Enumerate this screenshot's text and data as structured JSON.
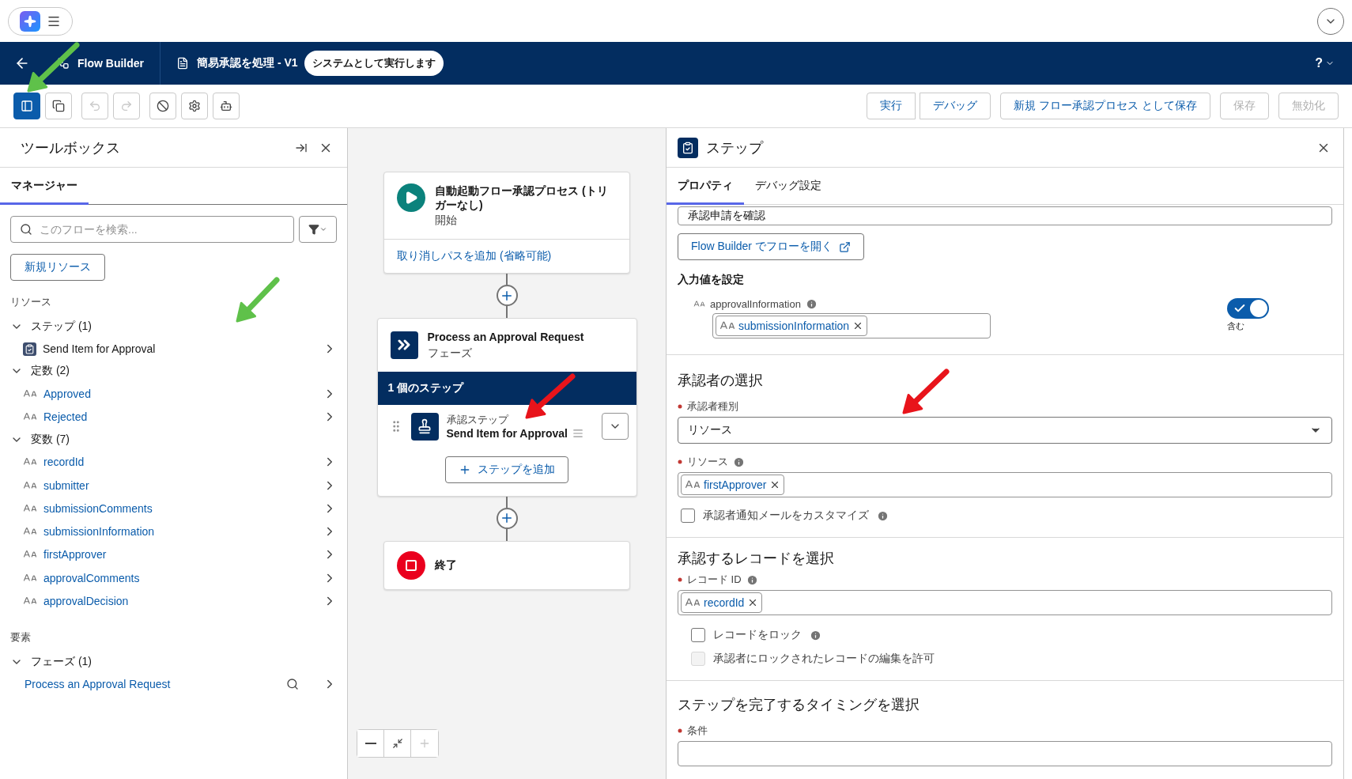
{
  "header": {
    "app_title": "Flow Builder",
    "flow_title": "簡易承認を処理 - V1",
    "run_mode": "システムとして実行します",
    "help": "?"
  },
  "toolbar": {
    "tools": [
      {
        "kind": "panel",
        "on": true,
        "disabled": false
      },
      {
        "kind": "copy",
        "on": false,
        "disabled": false
      },
      {
        "kind": "undo",
        "on": false,
        "disabled": true
      },
      {
        "kind": "redo",
        "on": false,
        "disabled": true
      },
      {
        "kind": "block",
        "on": false,
        "disabled": false
      },
      {
        "kind": "gear",
        "on": false,
        "disabled": false
      },
      {
        "kind": "robot",
        "on": false,
        "disabled": false
      }
    ],
    "actions": [
      {
        "label": "実行",
        "disabled": false,
        "grouped": true
      },
      {
        "label": "デバッグ",
        "disabled": false,
        "grouped": true
      },
      {
        "label": "新規 フロー承認プロセス として保存",
        "disabled": false,
        "grouped": false
      },
      {
        "label": "保存",
        "disabled": true,
        "grouped": false
      },
      {
        "label": "無効化",
        "disabled": true,
        "grouped": false
      }
    ]
  },
  "toolbox": {
    "title": "ツールボックス",
    "tabs": [
      {
        "label": "マネージャー",
        "selected": true
      }
    ],
    "search": {
      "placeholder": "このフローを検索..."
    },
    "new_resource": "新規リソース",
    "sections": [
      {
        "heading": "リソース",
        "groups": [
          {
            "label": "ステップ (1)",
            "expanded": true,
            "children": [
              {
                "name": "Send Item for Approval",
                "kind": "step"
              }
            ]
          },
          {
            "label": "定数 (2)",
            "expanded": true,
            "children": [
              {
                "name": "Approved",
                "kind": "text"
              },
              {
                "name": "Rejected",
                "kind": "text"
              }
            ]
          },
          {
            "label": "変数 (7)",
            "expanded": true,
            "children": [
              {
                "name": "recordId",
                "kind": "text"
              },
              {
                "name": "submitter",
                "kind": "text"
              },
              {
                "name": "submissionComments",
                "kind": "text"
              },
              {
                "name": "submissionInformation",
                "kind": "text"
              },
              {
                "name": "firstApprover",
                "kind": "text"
              },
              {
                "name": "approvalComments",
                "kind": "text"
              },
              {
                "name": "approvalDecision",
                "kind": "text"
              }
            ]
          }
        ]
      },
      {
        "heading": "要素",
        "groups": [
          {
            "label": "フェーズ (1)",
            "expanded": true,
            "children": [
              {
                "name": "Process an Approval Request",
                "kind": "phase"
              }
            ]
          }
        ]
      }
    ]
  },
  "canvas": {
    "start": {
      "title": "自動起動フロー承認プロセス (トリガーなし)",
      "subtitle": "開始",
      "link": "取り消しパスを追加 (省略可能)"
    },
    "phase": {
      "title": "Process an Approval Request",
      "subtitle": "フェーズ",
      "band": "1 個のステップ",
      "steps": [
        {
          "type_label": "承認ステップ",
          "name": "Send Item for Approval"
        }
      ],
      "add_step": "ステップを追加"
    },
    "end": {
      "title": "終了"
    }
  },
  "properties": {
    "title": "ステップ",
    "tabs": [
      {
        "label": "プロパティ",
        "selected": true
      },
      {
        "label": "デバッグ設定",
        "selected": false
      }
    ],
    "step_label_value": "承認申請を確認",
    "open_button": "Flow Builder でフローを開く",
    "inputs_heading": "入力値を設定",
    "input": {
      "label": "approvalInformation",
      "value": "submissionInformation",
      "include_label": "含む",
      "on": true
    },
    "approver": {
      "heading": "承認者の選択",
      "type_field": {
        "label": "承認者種別",
        "required": true,
        "value": "リソース"
      },
      "resource_field": {
        "label": "リソース",
        "required": true,
        "value": "firstApprover"
      },
      "customize": {
        "label": "承認者通知メールをカスタマイズ",
        "checked": false,
        "disabled": false
      }
    },
    "record": {
      "heading": "承認するレコードを選択",
      "id_field": {
        "label": "レコード ID",
        "required": true,
        "value": "recordId"
      },
      "options": [
        {
          "label": "レコードをロック",
          "checked": false,
          "disabled": false,
          "info": true
        },
        {
          "label": "承認者にロックされたレコードの編集を許可",
          "checked": false,
          "disabled": true,
          "info": false
        }
      ]
    },
    "completion": {
      "heading": "ステップを完了するタイミングを選択",
      "condition_label": "条件",
      "required": true
    }
  },
  "annotations": [
    {
      "color": "#5fc14a"
    },
    {
      "color": "#5fc14a"
    },
    {
      "color": "#e8141b"
    },
    {
      "color": "#e8141b"
    }
  ]
}
